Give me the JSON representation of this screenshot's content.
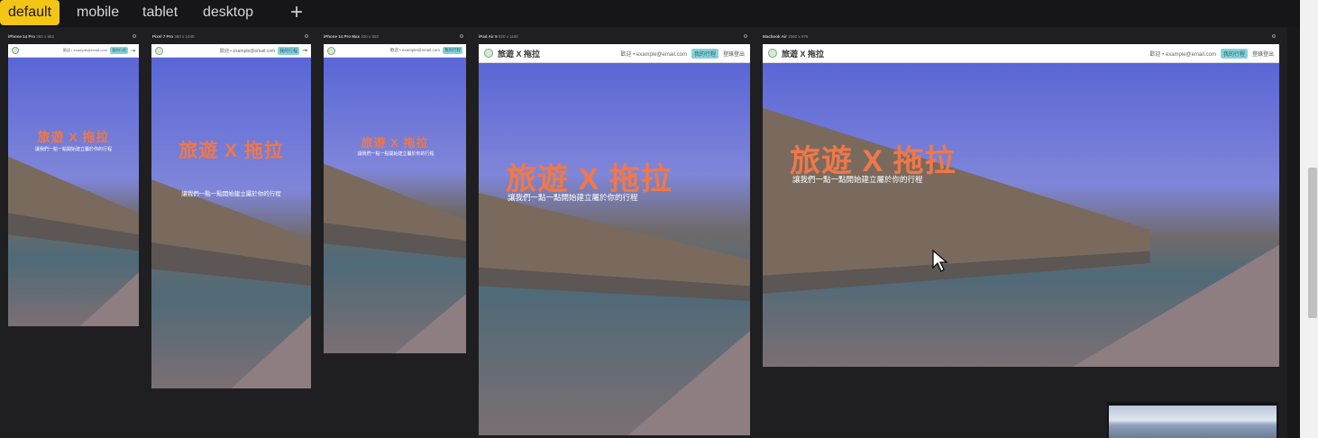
{
  "tabs": [
    {
      "label": "default"
    },
    {
      "label": "mobile"
    },
    {
      "label": "tablet"
    },
    {
      "label": "desktop"
    }
  ],
  "add_tab_label": "+",
  "devices": [
    {
      "name": "iPhone 14 Pro",
      "size": "393 x 852"
    },
    {
      "name": "Pixel 7 Pro",
      "size": "360 x 1040"
    },
    {
      "name": "iPhone 14 Pro Max",
      "size": "430 x 932"
    },
    {
      "name": "iPad Air 5",
      "size": "820 x 1180"
    },
    {
      "name": "Macbook Air",
      "size": "1560 x 975"
    }
  ],
  "site": {
    "brand": "旅遊 X 拖拉",
    "welcome": "歡迎 • example@email.com",
    "my_trips": "我的行程",
    "logout": "登錄登出",
    "hero_title": "旅遊 X 拖拉",
    "hero_subtitle": "讓我們一點一點開始建立屬於你的行程"
  },
  "colors": {
    "accent_tab": "#f3c516",
    "hero_title": "#f07848",
    "my_trips_button": "#86d3dc"
  },
  "icons": [
    "plus-icon",
    "settings-gear-icon",
    "logo-icon",
    "logout-icon",
    "mouse-cursor-icon"
  ]
}
